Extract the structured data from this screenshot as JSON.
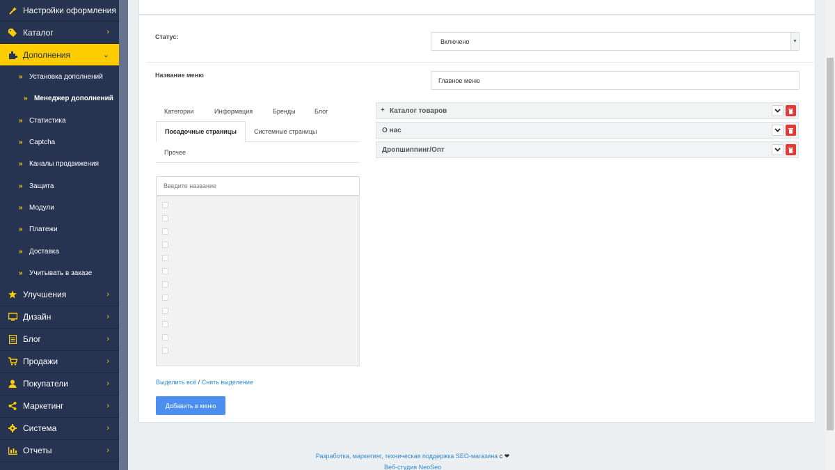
{
  "sidebar": {
    "items_top": [
      {
        "label": "Настройки оформления",
        "icon": "magic-wand-icon"
      },
      {
        "label": "Каталог",
        "icon": "tag-icon"
      },
      {
        "label": "Дополнения",
        "icon": "puzzle-icon"
      }
    ],
    "sub_items": [
      {
        "label": "Установка дополнений"
      },
      {
        "label": "Менеджер дополнений"
      },
      {
        "label": "Статистика"
      },
      {
        "label": "Captcha"
      },
      {
        "label": "Каналы продвижения"
      },
      {
        "label": "Защита"
      },
      {
        "label": "Модули"
      },
      {
        "label": "Платежи"
      },
      {
        "label": "Доставка"
      },
      {
        "label": "Учитывать в заказе"
      }
    ],
    "items_bottom": [
      {
        "label": "Улучшения",
        "icon": "star-icon"
      },
      {
        "label": "Дизайн",
        "icon": "monitor-icon"
      },
      {
        "label": "Блог",
        "icon": "document-icon"
      },
      {
        "label": "Продажи",
        "icon": "cart-icon"
      },
      {
        "label": "Покупатели",
        "icon": "user-icon"
      },
      {
        "label": "Маркетинг",
        "icon": "share-icon"
      },
      {
        "label": "Система",
        "icon": "gear-icon"
      },
      {
        "label": "Отчеты",
        "icon": "bar-chart-icon"
      }
    ],
    "accent": "#ffcc00",
    "background": "#263452"
  },
  "form": {
    "status_label": "Статус:",
    "status_value": "Включено",
    "menu_name_label": "Название меню",
    "menu_name_value": "Главное меню"
  },
  "tabs": {
    "categories": "Категории",
    "information": "Информация",
    "brands": "Бренды",
    "blog": "Блог",
    "landing_pages": "Посадочные страницы",
    "system_pages": "Системные страницы",
    "other": "Прочее"
  },
  "search": {
    "placeholder": "Введите название"
  },
  "selection": {
    "select_all": "Выделить всё",
    "separator": " / ",
    "deselect": "Снять выделение"
  },
  "add_button": "Добавить в меню",
  "menu_items": [
    {
      "title": "Каталог товаров",
      "has_children": true,
      "plus": "+"
    },
    {
      "title": "О нас",
      "has_children": false
    },
    {
      "title": "Дропшиппинг/Опт",
      "has_children": false
    }
  ],
  "footer": {
    "line1_link": "Разработка, маркетинг, техническая поддержка SEO-магазина",
    "line1_suffix": " с ",
    "line2_link": "Веб-студия NeoSeo"
  }
}
